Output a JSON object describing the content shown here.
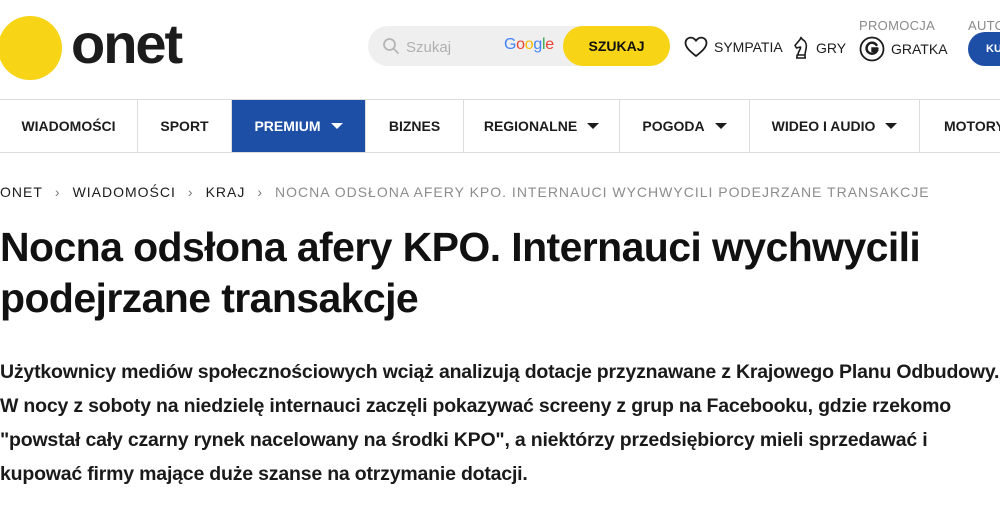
{
  "header": {
    "logo_text": "onet",
    "search": {
      "placeholder": "Szukaj",
      "provider": "Google",
      "button_label": "SZUKAJ"
    },
    "links": [
      {
        "label": "SYMPATIA",
        "icon": "heart-icon"
      },
      {
        "label": "GRY",
        "icon": "chess-knight-icon"
      },
      {
        "label": "GRATKA",
        "icon": "gratka-logo-icon"
      }
    ],
    "promo_label": "PROMOCJA",
    "auto_label": "AUTO",
    "auto_button_label": "KU"
  },
  "nav": {
    "items": [
      {
        "label": "WIADOMOŚCI",
        "dropdown": false
      },
      {
        "label": "SPORT",
        "dropdown": false
      },
      {
        "label": "PREMIUM",
        "dropdown": true,
        "active": true
      },
      {
        "label": "BIZNES",
        "dropdown": false
      },
      {
        "label": "REGIONALNE",
        "dropdown": true
      },
      {
        "label": "POGODA",
        "dropdown": true
      },
      {
        "label": "WIDEO I AUDIO",
        "dropdown": true
      },
      {
        "label": "MOTORY",
        "dropdown": false
      }
    ]
  },
  "breadcrumb": {
    "items": [
      "ONET",
      "WIADOMOŚCI",
      "KRAJ"
    ],
    "current": "NOCNA ODSŁONA AFERY KPO. INTERNAUCI WYCHWYCILI PODEJRZANE TRANSAKCJE"
  },
  "article": {
    "title": "Nocna odsłona afery KPO. Internauci wychwycili podejrzane transakcje",
    "lead": "Użytkownicy mediów społecznościowych wciąż analizują dotacje przyznawane z Krajowego Planu Odbudowy. W nocy z soboty na niedzielę internauci zaczęli pokazywać screeny z grup na Facebooku, gdzie rzekomo \"powstał cały czarny rynek nacelowany na środki KPO\", a niektórzy przedsiębiorcy mieli sprzedawać i kupować firmy mające duże szanse na otrzymanie dotacji."
  },
  "colors": {
    "brand_yellow": "#f7d416",
    "nav_active_blue": "#1d4fa6",
    "google_blue": "#4285F4",
    "google_red": "#EA4335",
    "google_yellow": "#FBBC05",
    "google_green": "#34A853"
  }
}
